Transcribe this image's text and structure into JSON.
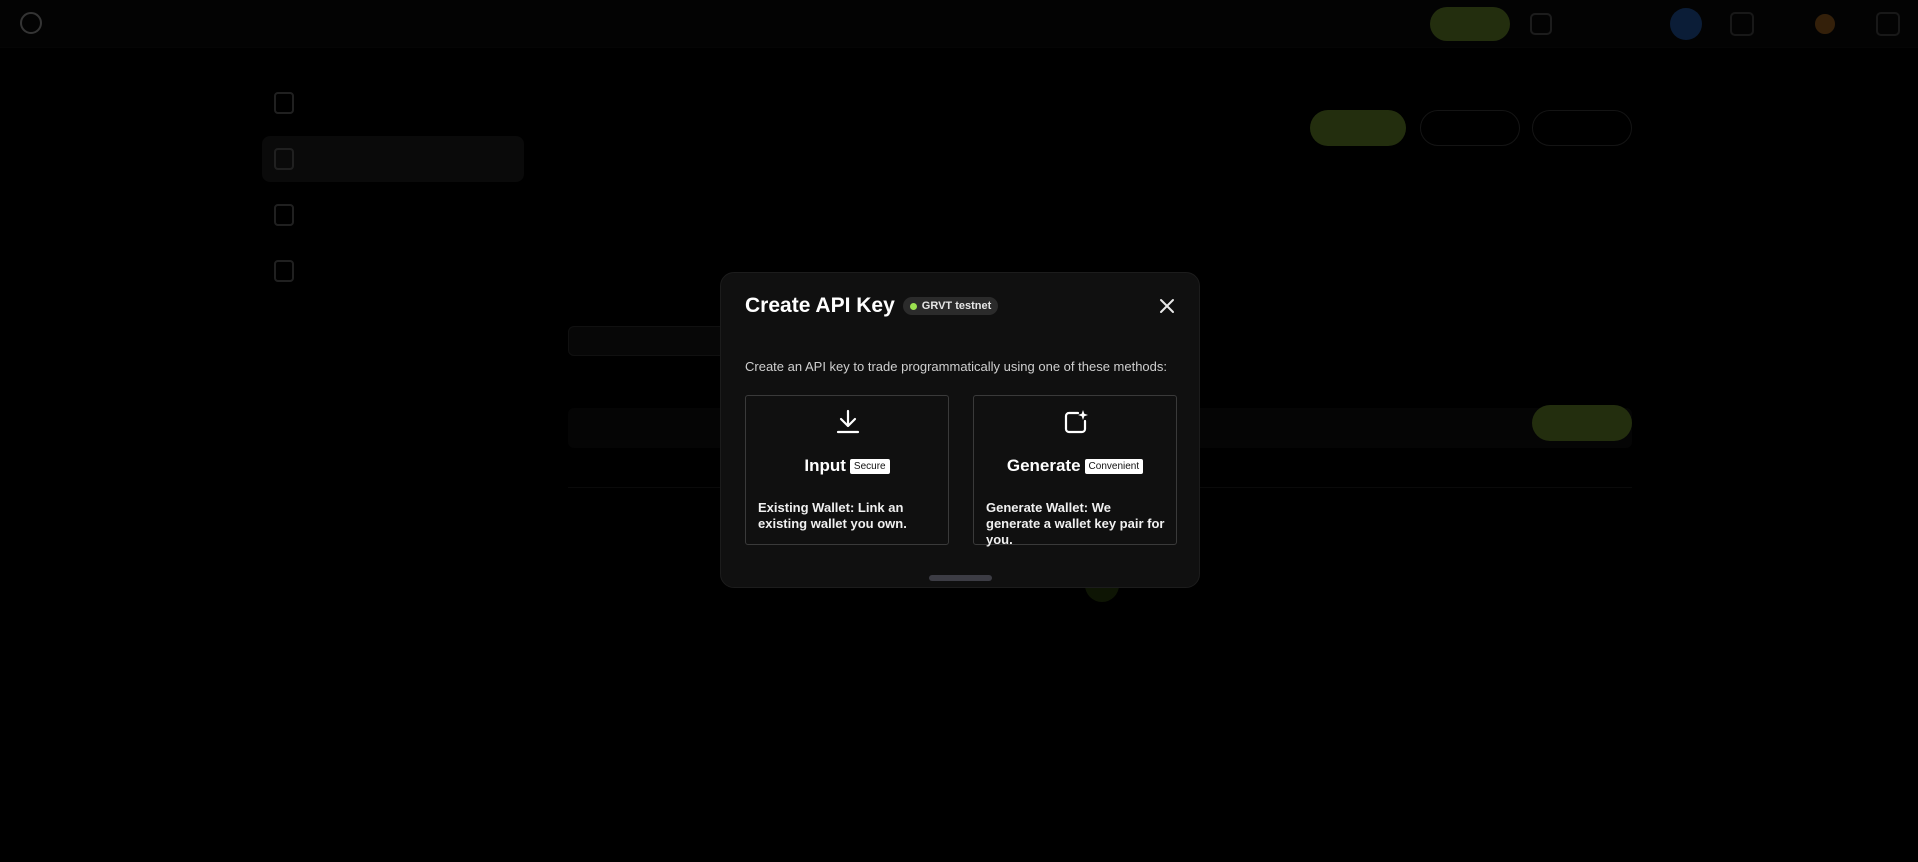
{
  "modal": {
    "title": "Create API Key",
    "network_badge": "GRVT testnet",
    "description": "Create an API key to trade programmatically using one of these methods:",
    "options": [
      {
        "title": "Input",
        "tag": "Secure",
        "description": "Existing Wallet: Link an existing wallet you own.",
        "icon": "download-icon"
      },
      {
        "title": "Generate",
        "tag": "Convenient",
        "description": "Generate Wallet: We generate a wallet key pair for you.",
        "icon": "new-window-sparkle-icon"
      }
    ]
  },
  "colors": {
    "accent_green": "#93c23a",
    "badge_dot": "#9be04f",
    "modal_bg": "#101010",
    "overlay": "rgba(0,0,0,0.76)"
  }
}
